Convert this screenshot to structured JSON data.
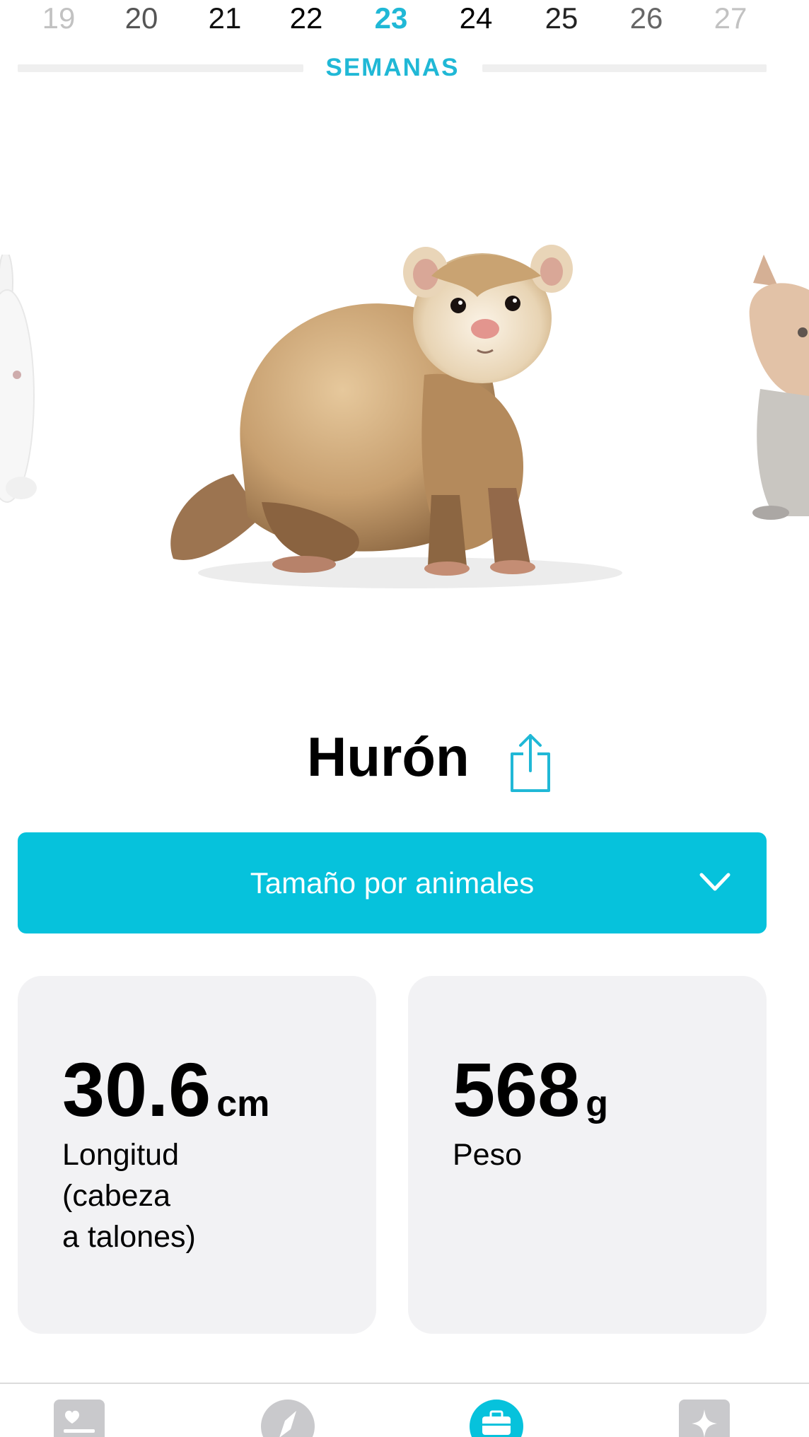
{
  "weeks": {
    "items": [
      "19",
      "20",
      "21",
      "22",
      "23",
      "24",
      "25",
      "26",
      "27"
    ],
    "selected": "23",
    "label": "SEMANAS"
  },
  "carousel": {
    "current_animal": "ferret",
    "previous_animal": "rabbit",
    "next_animal": "fox"
  },
  "animal": {
    "name": "Hurón",
    "share_icon": "share-icon"
  },
  "dropdown": {
    "label": "Tamaño por animales",
    "icon": "chevron-down-icon"
  },
  "stats": {
    "length": {
      "value": "30.6",
      "unit": "cm",
      "label": "Longitud\n(cabeza\na talones)"
    },
    "weight": {
      "value": "568",
      "unit": "g",
      "label": "Peso"
    }
  },
  "tabbar": {
    "tabs": [
      {
        "icon": "journal-icon"
      },
      {
        "icon": "compass-icon"
      },
      {
        "icon": "briefcase-icon",
        "active": true
      },
      {
        "icon": "sparkle-icon"
      }
    ]
  },
  "colors": {
    "accent": "#06c2dc",
    "week_selected": "#20b8d6",
    "card_bg": "#f2f2f4",
    "tab_inactive": "#c9c9cc"
  }
}
